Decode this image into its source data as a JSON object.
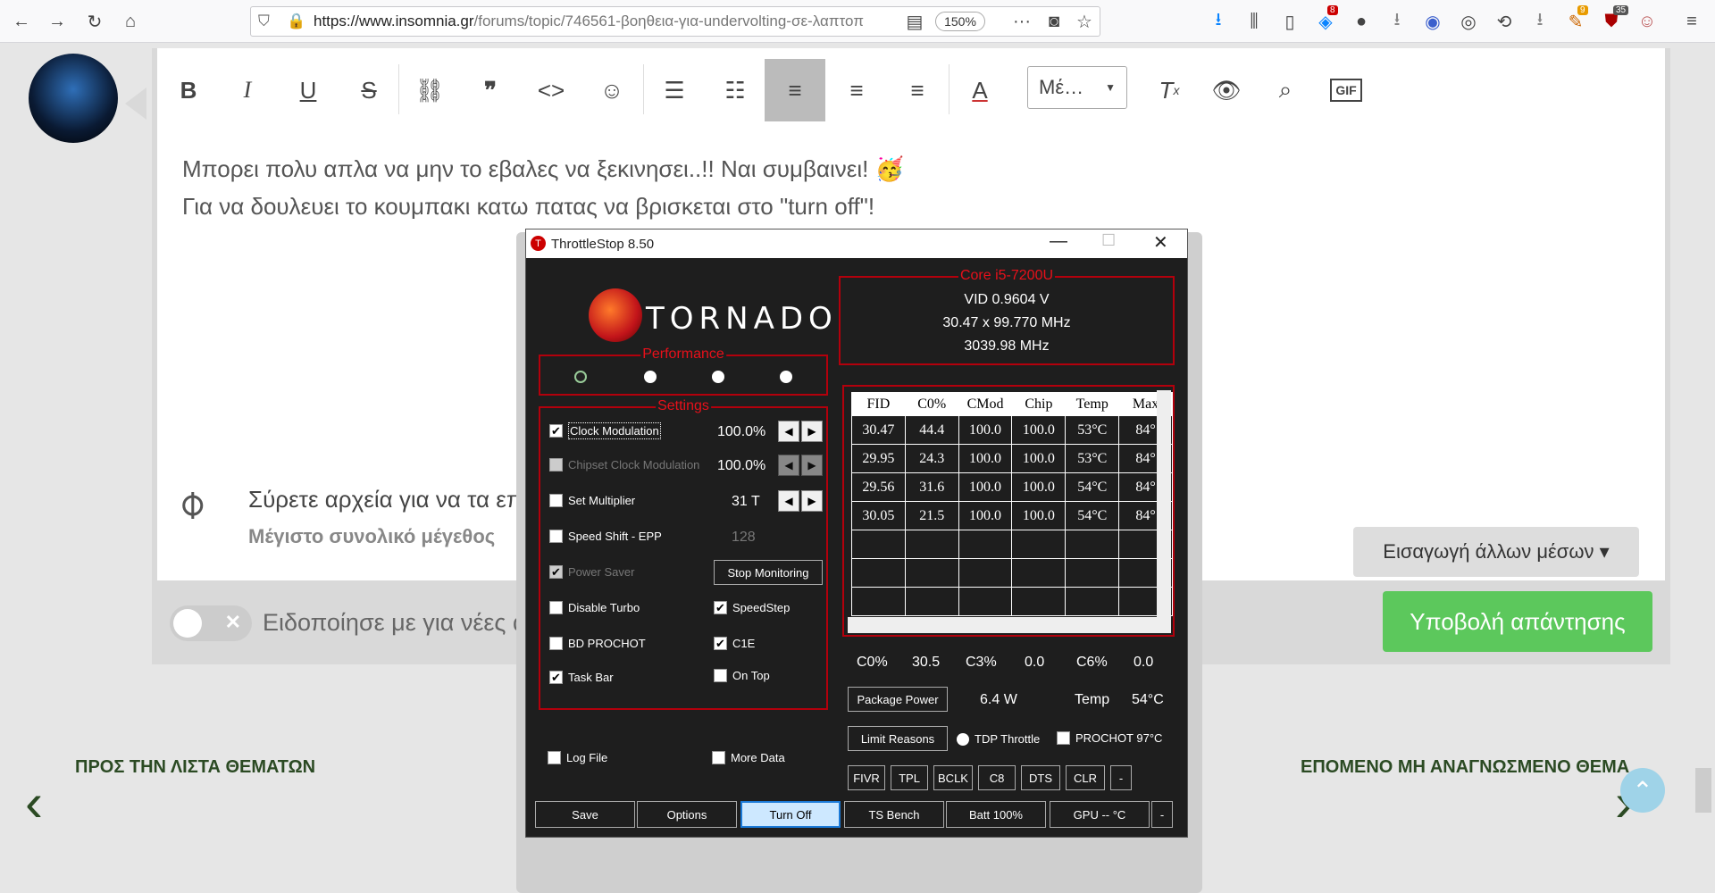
{
  "browser": {
    "url_domain": "https://www.insomnia.gr",
    "url_path": "/forums/topic/746561-βοηθεια-για-undervolting-σε-λαπτοπ",
    "zoom": "150%",
    "badges": {
      "ext1": "8",
      "ext2": "9",
      "ext3": "35"
    }
  },
  "editor": {
    "font_menu": "Μέ…",
    "line1": "Μπορει πολυ απλα να μην το εβαλες να ξεκινησει..!! Ναι συμβαινει! 🥳",
    "line2": "Για να δουλευει το κουμπακι κατω πατας να βρισκεται στο \"turn off\"!",
    "attach_title": "Σύρετε αρχεία για να τα επ",
    "attach_sub": "Μέγιστο συνολικό μέγεθος",
    "insert_media": "Εισαγωγή άλλων μέσων ▾",
    "notify": "Ειδοποίησε με για νέες α",
    "submit": "Υποβολή απάντησης"
  },
  "nav": {
    "back_list": "ΠΡΟΣ ΤΗΝ ΛΙΣΤΑ ΘΕΜΑΤΩΝ",
    "next_unread": "ΕΠΟΜΕΝΟ ΜΗ ΑΝΑΓΝΩΣΜΕΝΟ ΘΕΜΑ"
  },
  "ts": {
    "title": "ThrottleStop 8.50",
    "logo": "TORNADO",
    "core": {
      "label": "Core i5-7200U",
      "vid": "VID  0.9604 V",
      "mult": "30.47 x 99.770 MHz",
      "freq": "3039.98 MHz"
    },
    "performance_label": "Performance",
    "settings_label": "Settings",
    "settings": {
      "clock_mod": "Clock Modulation",
      "clock_mod_val": "100.0%",
      "chipset_mod": "Chipset Clock Modulation",
      "chipset_mod_val": "100.0%",
      "set_mult": "Set Multiplier",
      "set_mult_val": "31 T",
      "speed_shift": "Speed Shift - EPP",
      "speed_shift_val": "128",
      "power_saver": "Power Saver",
      "stop_monitoring": "Stop Monitoring",
      "disable_turbo": "Disable Turbo",
      "speedstep": "SpeedStep",
      "bd_prochot": "BD PROCHOT",
      "c1e": "C1E",
      "task_bar": "Task Bar",
      "on_top": "On Top",
      "log_file": "Log File",
      "more_data": "More Data"
    },
    "table": {
      "headers": [
        "FID",
        "C0%",
        "CMod",
        "Chip",
        "Temp",
        "Max"
      ],
      "rows": [
        [
          "30.47",
          "44.4",
          "100.0",
          "100.0",
          "53°C",
          "84°"
        ],
        [
          "29.95",
          "24.3",
          "100.0",
          "100.0",
          "53°C",
          "84°"
        ],
        [
          "29.56",
          "31.6",
          "100.0",
          "100.0",
          "54°C",
          "84°"
        ],
        [
          "30.05",
          "21.5",
          "100.0",
          "100.0",
          "54°C",
          "84°"
        ]
      ]
    },
    "cstates": {
      "c0_label": "C0%",
      "c0": "30.5",
      "c3_label": "C3%",
      "c3": "0.0",
      "c6_label": "C6%",
      "c6": "0.0"
    },
    "package_power": "Package Power",
    "power_val": "6.4 W",
    "temp_label": "Temp",
    "temp_val": "54°C",
    "limit_reasons": "Limit Reasons",
    "tdp_throttle": "TDP Throttle",
    "prochot": "PROCHOT 97°C",
    "small_buttons": [
      "FIVR",
      "TPL",
      "BCLK",
      "C8",
      "DTS",
      "CLR",
      "-"
    ],
    "bottom_buttons": [
      "Save",
      "Options",
      "Turn Off",
      "TS Bench",
      "Batt 100%",
      "GPU -- °C",
      "-"
    ]
  }
}
